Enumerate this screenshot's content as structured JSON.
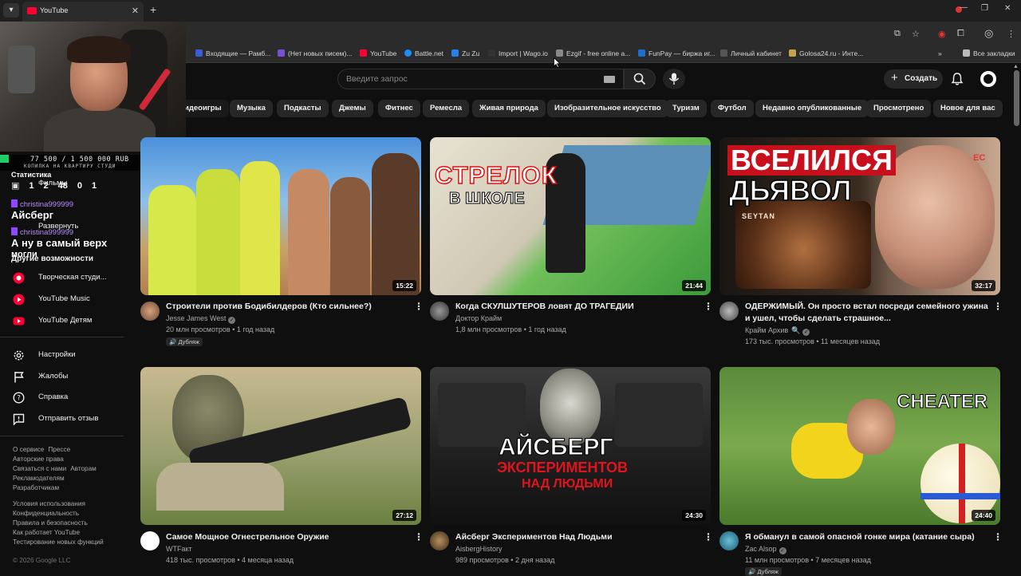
{
  "browser": {
    "tab_title": "YouTube",
    "bookmarks": [
      {
        "label": "Входящие — Рамб...",
        "color": "#3b5bdb"
      },
      {
        "label": "(Нет новых писем)...",
        "color": "#7a4fd6"
      },
      {
        "label": "YouTube",
        "color": "#ff0033"
      },
      {
        "label": "Battle.net",
        "color": "#1c8fff"
      },
      {
        "label": "Zu Zu",
        "color": "#2d7ee8"
      },
      {
        "label": "Import | Wago.io",
        "color": "#333333"
      },
      {
        "label": "Ezgif - free online a...",
        "color": "#888888"
      },
      {
        "label": "FunPay — биржа иг...",
        "color": "#1f6fd1"
      },
      {
        "label": "Личный кабинет",
        "color": "#555555"
      },
      {
        "label": "Golosa24.ru - Инте...",
        "color": "#c8a24b"
      }
    ],
    "all_bookmarks": "Все закладки"
  },
  "header": {
    "search_placeholder": "Введите запрос",
    "create_label": "Создать"
  },
  "chips": [
    "идеоигры",
    "Музыка",
    "Подкасты",
    "Джемы",
    "Фитнес",
    "Ремесла",
    "Живая природа",
    "Изобразительное искусство",
    "Туризм",
    "Футбол",
    "Недавно опубликованные",
    "Просмотрено",
    "Новое для вас"
  ],
  "sidebar": {
    "other_heading": "Другие возможности",
    "other_items": [
      "Творческая студи...",
      "YouTube Music",
      "YouTube Детям"
    ],
    "settings_items": [
      "Настройки",
      "Жалобы",
      "Справка",
      "Отправить отзыв"
    ],
    "footer1": [
      "О сервисе",
      "Прессе",
      "Авторские права",
      "Связаться с нами",
      "Авторам",
      "Рекламодателям",
      "Разработчикам"
    ],
    "footer2": [
      "Условия использования",
      "Конфиденциальность",
      "Правила и безопасность",
      "Как работает YouTube",
      "Тестирование новых функций"
    ],
    "copyright": "© 2026 Google LLC",
    "expand_label": "Развернуть",
    "films_label": "Фильмы"
  },
  "overlay": {
    "goal_value": "77 500 / 1 500 000 RUB",
    "goal_subtitle": "КОПИЛКА НА КВАРТИРУ СТУДИ",
    "goal_progress": 0.052,
    "stats_title": "Статистика",
    "stats": [
      "1",
      "2",
      "48",
      "0",
      "1"
    ],
    "chat": [
      {
        "user": "christina999999",
        "msg": "Айсберг"
      },
      {
        "user": "christina999999",
        "msg": "А ну в самый верх"
      }
    ],
    "msg_tail": "могли"
  },
  "videos": [
    {
      "title": "Строители против Бодибилдеров (Кто сильнее?)",
      "channel": "Jesse James West",
      "verified": true,
      "meta": "20 млн просмотров • 1 год назад",
      "badge": "Дубляж",
      "duration": "15:22"
    },
    {
      "title": "Когда СКУЛШУТЕРОВ ловят ДО ТРАГЕДИИ",
      "channel": "Доктор Крайм",
      "verified": false,
      "meta": "1,8 млн просмотров • 1 год назад",
      "badge": "",
      "duration": "21:44",
      "thumb_text1": "СТРЕЛОК",
      "thumb_text2": "В ШКОЛЕ"
    },
    {
      "title": "ОДЕРЖИМЫЙ. Он просто встал посреди семейного ужина и ушел, чтобы сделать страшное...",
      "channel": "Крайм Архив",
      "verified": true,
      "meta": "173 тыс. просмотров • 11 месяцев назад",
      "badge": "",
      "duration": "32:17",
      "thumb_text1": "ВСЕЛИЛСЯ",
      "thumb_text2": "ДЬЯВОЛ",
      "thumb_small": "SEYTAN",
      "thumb_ec": "EC"
    },
    {
      "title": "Самое Мощное Огнестрельное Оружие",
      "channel": "WTFакт",
      "verified": false,
      "meta": "418 тыс. просмотров • 4 месяца назад",
      "badge": "",
      "duration": "27:12"
    },
    {
      "title": "Айсберг Экспериментов Над Людьми",
      "channel": "AisbergHistory",
      "verified": false,
      "meta": "989 просмотров • 2 дня назад",
      "badge": "",
      "duration": "24:30",
      "thumb_text1": "АЙСБЕРГ",
      "thumb_text2": "ЭКСПЕРИМЕНТОВ",
      "thumb_text3": "НАД ЛЮДЬМИ"
    },
    {
      "title": "Я обманул в самой опасной гонке мира (катание сыра)",
      "channel": "Zac Alsop",
      "verified": true,
      "meta": "11 млн просмотров • 7 месяцев назад",
      "badge": "Дубляж",
      "duration": "24:40",
      "thumb_text1": "CHEATER"
    }
  ],
  "colors": {
    "accent": "#ff0033",
    "bg": "#0f0f0f",
    "chip": "#272727"
  }
}
